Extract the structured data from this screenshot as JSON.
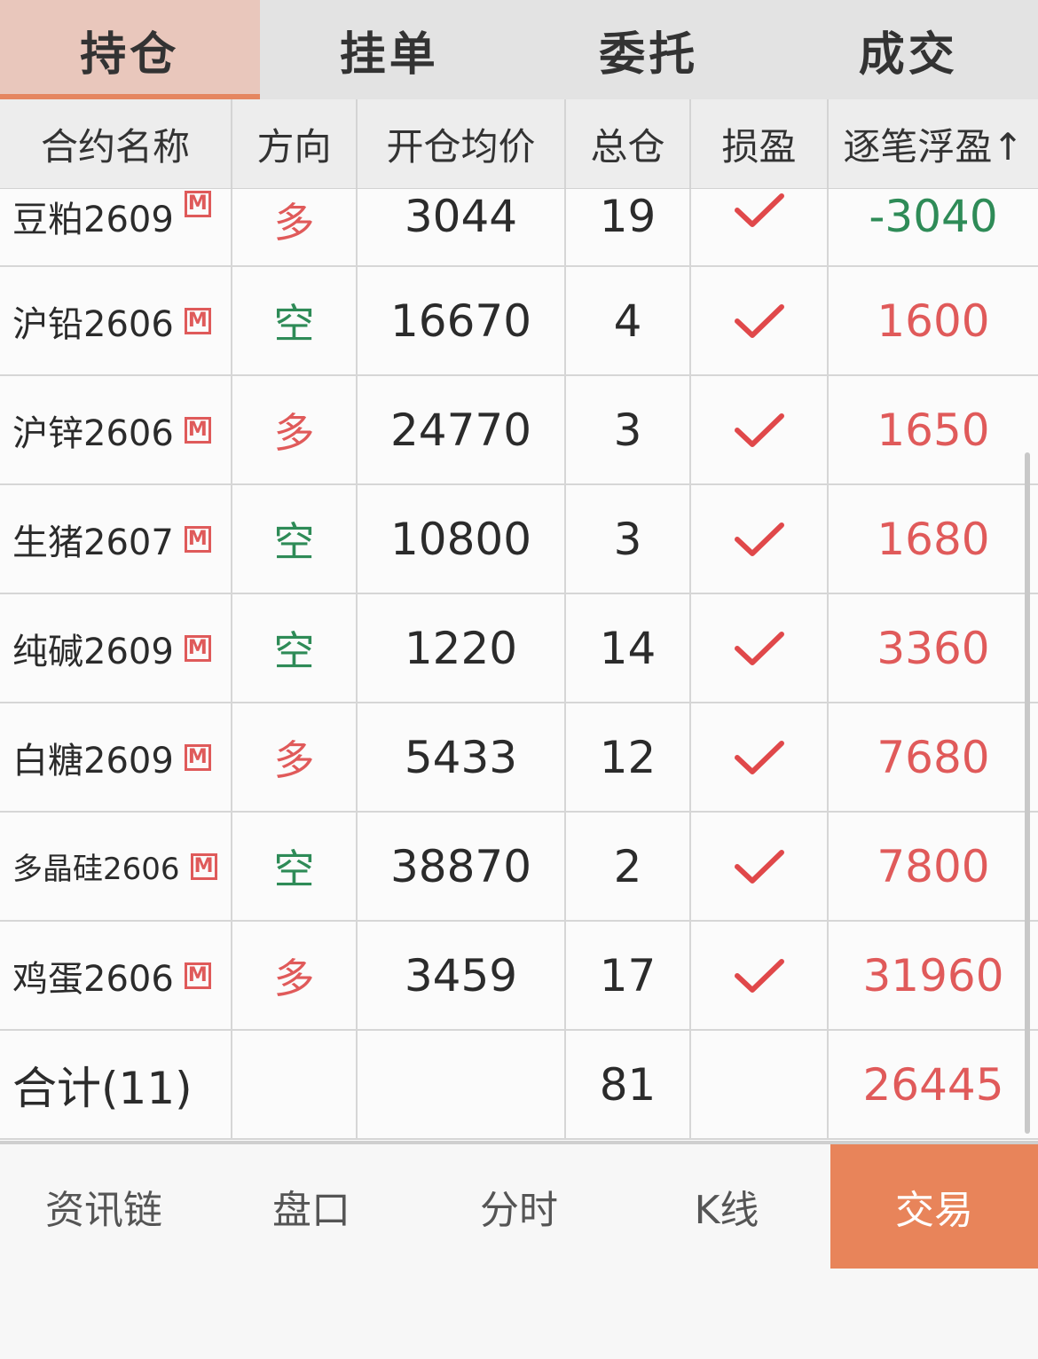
{
  "tabs": [
    {
      "label": "持仓",
      "active": true
    },
    {
      "label": "挂单",
      "active": false
    },
    {
      "label": "委托",
      "active": false
    },
    {
      "label": "成交",
      "active": false
    }
  ],
  "columns": [
    "合约名称",
    "方向",
    "开仓均价",
    "总仓",
    "损盈",
    "逐笔浮盈↑"
  ],
  "badge": "M",
  "rows": [
    {
      "name": "豆粕2609",
      "direction": "多",
      "avg_price": "3044",
      "total": "19",
      "profit": "-3040"
    },
    {
      "name": "沪铅2606",
      "direction": "空",
      "avg_price": "16670",
      "total": "4",
      "profit": "1600"
    },
    {
      "name": "沪锌2606",
      "direction": "多",
      "avg_price": "24770",
      "total": "3",
      "profit": "1650"
    },
    {
      "name": "生猪2607",
      "direction": "空",
      "avg_price": "10800",
      "total": "3",
      "profit": "1680"
    },
    {
      "name": "纯碱2609",
      "direction": "空",
      "avg_price": "1220",
      "total": "14",
      "profit": "3360"
    },
    {
      "name": "白糖2609",
      "direction": "多",
      "avg_price": "5433",
      "total": "12",
      "profit": "7680"
    },
    {
      "name": "多晶硅2606",
      "direction": "空",
      "avg_price": "38870",
      "total": "2",
      "profit": "7800"
    },
    {
      "name": "鸡蛋2606",
      "direction": "多",
      "avg_price": "3459",
      "total": "17",
      "profit": "31960"
    }
  ],
  "summary": {
    "label": "合计(11)",
    "total": "81",
    "profit": "26445"
  },
  "bottom_nav": [
    {
      "label": "资讯链",
      "active": false
    },
    {
      "label": "盘口",
      "active": false
    },
    {
      "label": "分时",
      "active": false
    },
    {
      "label": "K线",
      "active": false
    },
    {
      "label": "交易",
      "active": true
    }
  ],
  "colors": {
    "long": "#e05a5a",
    "short": "#2e8b57",
    "accent": "#e8845a",
    "check": "#e0484a"
  },
  "icons": {
    "stop_loss_profit": "check-icon",
    "contract_badge": "m-badge-icon"
  }
}
